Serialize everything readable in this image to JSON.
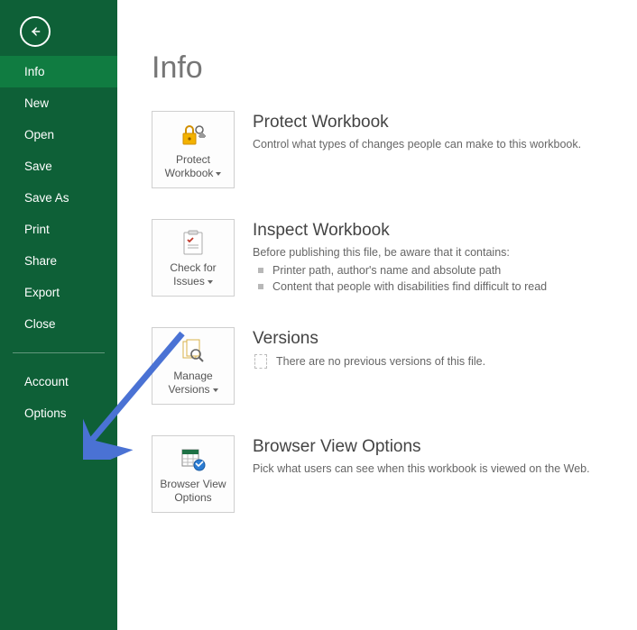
{
  "page_title": "Info",
  "sidebar": {
    "items": [
      {
        "label": "Info",
        "selected": true
      },
      {
        "label": "New"
      },
      {
        "label": "Open"
      },
      {
        "label": "Save"
      },
      {
        "label": "Save As"
      },
      {
        "label": "Print"
      },
      {
        "label": "Share"
      },
      {
        "label": "Export"
      },
      {
        "label": "Close"
      }
    ],
    "footer_items": [
      {
        "label": "Account"
      },
      {
        "label": "Options"
      }
    ]
  },
  "sections": {
    "protect": {
      "tile_label_line1": "Protect",
      "tile_label_line2": "Workbook",
      "heading": "Protect Workbook",
      "desc": "Control what types of changes people can make to this workbook."
    },
    "inspect": {
      "tile_label_line1": "Check for",
      "tile_label_line2": "Issues",
      "heading": "Inspect Workbook",
      "desc": "Before publishing this file, be aware that it contains:",
      "bullets": [
        "Printer path, author's name and absolute path",
        "Content that people with disabilities find difficult to read"
      ]
    },
    "versions": {
      "tile_label_line1": "Manage",
      "tile_label_line2": "Versions",
      "heading": "Versions",
      "desc": "There are no previous versions of this file."
    },
    "browser": {
      "tile_label_line1": "Browser View",
      "tile_label_line2": "Options",
      "heading": "Browser View Options",
      "desc": "Pick what users can see when this workbook is viewed on the Web."
    }
  }
}
